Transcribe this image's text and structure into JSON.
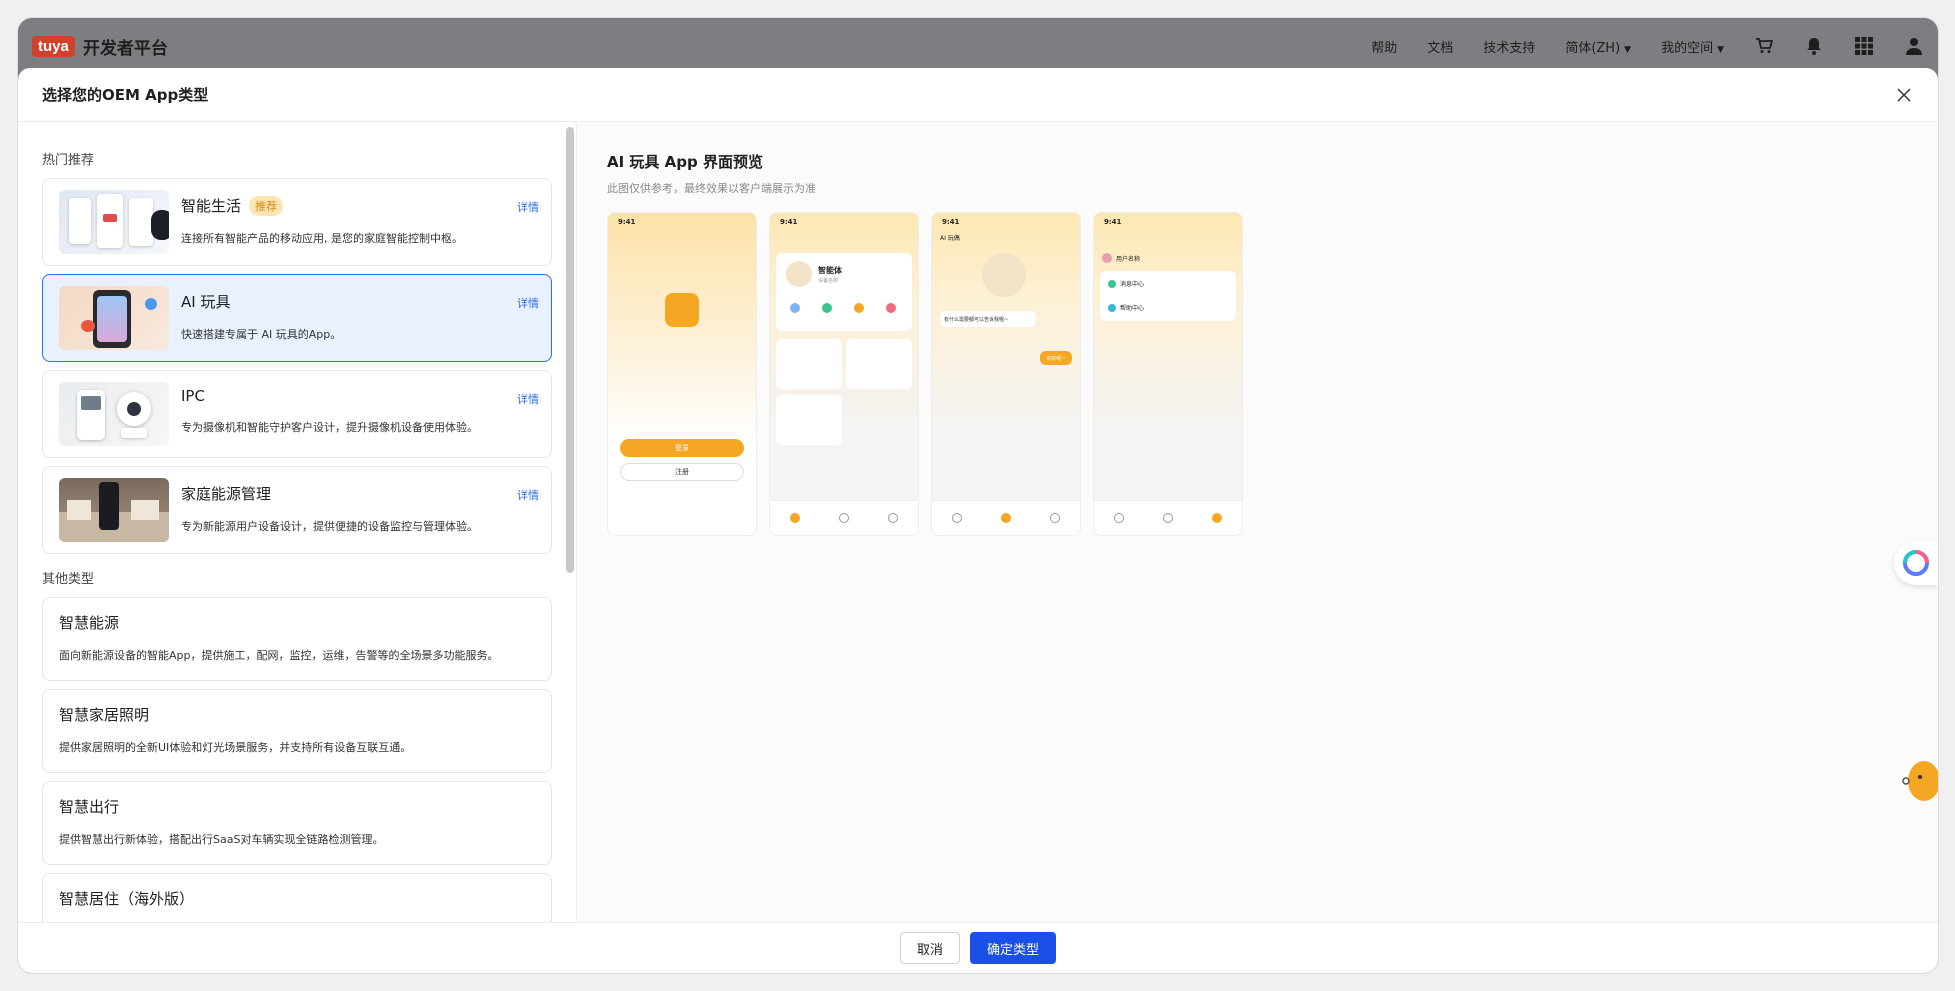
{
  "topbar": {
    "logo_badge": "tuya",
    "logo_text": "开发者平台",
    "nav": [
      "帮助",
      "文档",
      "技术支持"
    ],
    "language": "简体(ZH)",
    "my_space": "我的空间"
  },
  "modal": {
    "title": "选择您的OEM App类型",
    "hot_section": "热门推荐",
    "other_section": "其他类型",
    "detail_label": "详情",
    "hot_items": [
      {
        "name": "智能生活",
        "badge": "推荐",
        "desc": "连接所有智能产品的移动应用, 是您的家庭智能控制中枢。"
      },
      {
        "name": "AI 玩具",
        "desc": "快速搭建专属于 AI 玩具的App。"
      },
      {
        "name": "IPC",
        "desc": "专为摄像机和智能守护客户设计，提升摄像机设备使用体验。"
      },
      {
        "name": "家庭能源管理",
        "desc": "专为新能源用户设备设计，提供便捷的设备监控与管理体验。"
      }
    ],
    "other_items": [
      {
        "name": "智慧能源",
        "desc": "面向新能源设备的智能App，提供施工，配网，监控，运维，告警等的全场景多功能服务。"
      },
      {
        "name": "智慧家居照明",
        "desc": "提供家居照明的全新UI体验和灯光场景服务，并支持所有设备互联互通。"
      },
      {
        "name": "智慧出行",
        "desc": "提供智慧出行新体验，搭配出行SaaS对车辆实现全链路检测管理。"
      },
      {
        "name": "智慧居住（海外版）",
        "desc": ""
      }
    ],
    "preview": {
      "title": "AI 玩具 App 界面预览",
      "subtitle": "此图仅供参考，最终效果以客户端展示为准",
      "time": "9:41",
      "phone1": {
        "login": "登录",
        "register": "注册"
      },
      "phone2": {
        "agent": "智能体",
        "agent_sub": "设备名称"
      },
      "phone3": {
        "menu": "AI 玩偶",
        "bubble": "有什么需要都可以告诉我喔~",
        "reply": "你好呀~"
      },
      "phone4": {
        "user": "用户名称",
        "msg_center": "消息中心",
        "help_center": "帮助中心"
      }
    },
    "cancel_label": "取消",
    "confirm_label": "确定类型"
  },
  "colors": {
    "primary": "#1a50e8",
    "selected_bg": "#e9f1fe",
    "badge": "#fde4b5",
    "accent": "#f5a623"
  }
}
